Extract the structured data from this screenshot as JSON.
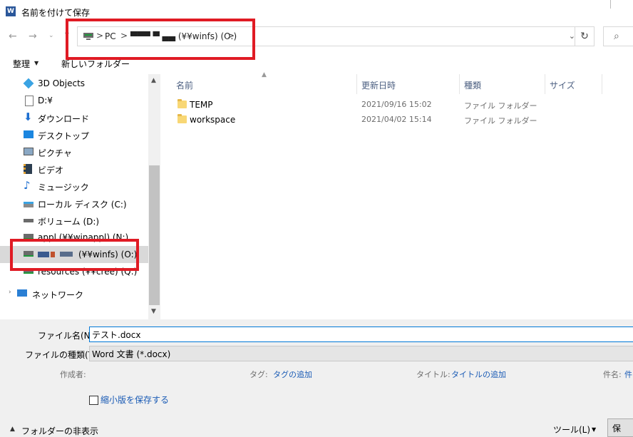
{
  "window": {
    "title": "名前を付けて保存",
    "app_icon_letter": "W"
  },
  "addressbar": {
    "crumbs": [
      "PC",
      "▀▀▀ ▀ ▄▄ (¥¥winfs) (O:)"
    ],
    "separator": ">",
    "dropdown_glyph": "⌄",
    "refresh_glyph": "↻",
    "search_glyph": "⌕"
  },
  "toolbar": {
    "organize": "整理",
    "new_folder": "新しいフォルダー"
  },
  "nav": {
    "items": [
      {
        "label": "3D Objects",
        "icon": "cube-icon"
      },
      {
        "label": "D:¥",
        "icon": "drive-icon"
      },
      {
        "label": "ダウンロード",
        "icon": "download-icon"
      },
      {
        "label": "デスクトップ",
        "icon": "desktop-icon"
      },
      {
        "label": "ピクチャ",
        "icon": "picture-icon"
      },
      {
        "label": "ビデオ",
        "icon": "video-icon"
      },
      {
        "label": "ミュージック",
        "icon": "music-icon"
      },
      {
        "label": "ローカル ディスク (C:)",
        "icon": "disk-icon"
      },
      {
        "label": "ボリューム (D:)",
        "icon": "disk-icon"
      },
      {
        "label": "appl (¥¥winappl) (N:)",
        "icon": "network-drive-icon"
      },
      {
        "label": "(¥¥winfs) (O:)",
        "icon": "network-drive-icon"
      },
      {
        "label": "resources (¥¥cree) (Q:)",
        "icon": "network-drive-icon"
      },
      {
        "label": "ネットワーク",
        "icon": "network-icon"
      }
    ]
  },
  "filelist": {
    "columns": [
      "名前",
      "更新日時",
      "種類",
      "サイズ"
    ],
    "rows": [
      {
        "name": "TEMP",
        "date": "2021/09/16 15:02",
        "type": "ファイル フォルダー"
      },
      {
        "name": "workspace",
        "date": "2021/04/02 15:14",
        "type": "ファイル フォルダー"
      }
    ]
  },
  "form": {
    "filename_label": "ファイル名(N):",
    "filename_value": "テスト.docx",
    "filetype_label": "ファイルの種類(T):",
    "filetype_value": "Word 文書 (*.docx)",
    "author_label": "作成者:",
    "tags_label": "タグ:",
    "tags_value": "タグの追加",
    "title_label": "タイトル:",
    "title_value": "タイトルの追加",
    "subject_label": "件名:",
    "subject_value": "件",
    "thumbnail_label": "縮小版を保存する",
    "hide_folders": "フォルダーの非表示",
    "tools": "ツール(L)",
    "save": "保"
  }
}
